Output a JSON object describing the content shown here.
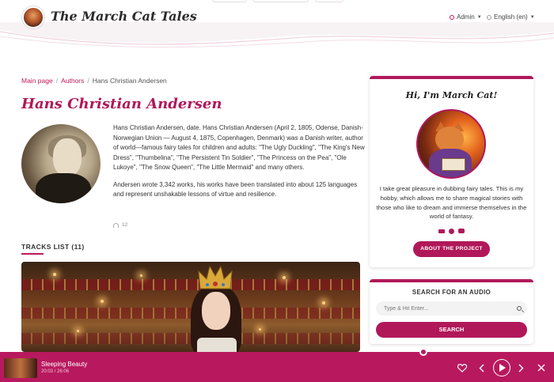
{
  "site": {
    "title": "The March Cat Tales"
  },
  "header": {
    "admin_label": "Admin",
    "language_label": "English (en)"
  },
  "breadcrumb": {
    "home": "Main page",
    "authors": "Authors",
    "current": "Hans Christian Andersen"
  },
  "author": {
    "name": "Hans Christian Andersen",
    "bio_1": "Hans Christian Andersen, date. Hans Christian Andersen (April 2, 1805, Odense, Danish-Norwegian Union — August 4, 1875, Copenhagen, Denmark) was a Danish writer, author of world—famous fairy tales for children and adults: \"The Ugly Duckling\", \"The King's New Dress\", \"Thumbelina\", \"The Persistent Tin Soldier\", \"The Princess on the Pea\", \"Ole Lukoye\", \"The Snow Queen\", \"The Little Mermaid\" and many others.",
    "bio_2": "Andersen wrote 3,342 works, his works have been translated into about 125 languages and represent unshakable lessons of virtue and resilience.",
    "listens": "12"
  },
  "tracks": {
    "heading": "TRACKS LIST (11)"
  },
  "about": {
    "title": "Hi, I'm March Cat!",
    "text": "I take great pleasure in dubbing fairy tales. This is my hobby, which allows me to share magical stories with those who like to dream and immerse themselves in the world of fantasy.",
    "button": "ABOUT THE PROJECT",
    "socials": [
      "vk-icon",
      "telegram-icon",
      "youtube-icon"
    ]
  },
  "search": {
    "title": "SEARCH FOR AN AUDIO",
    "placeholder": "Type & Hit Enter...",
    "button": "SEARCH"
  },
  "player": {
    "title": "Sleeping Beauty",
    "time": "20:03 / 26:06",
    "progress": 0.768
  },
  "colors": {
    "accent": "#b0185a",
    "player_bg": "#b8195e"
  }
}
